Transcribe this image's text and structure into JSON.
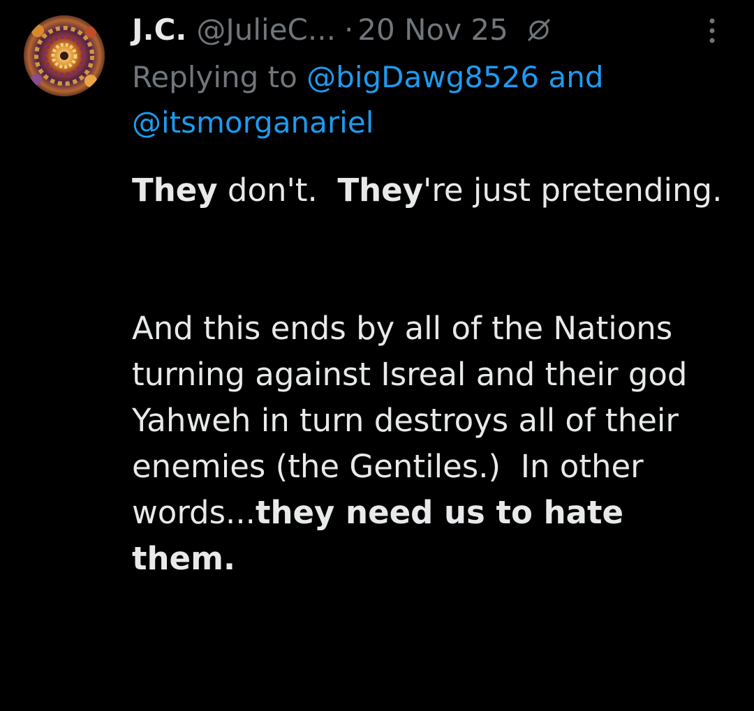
{
  "tweet": {
    "author_name": "J.C.",
    "author_handle": "@JulieC...",
    "separator": "·",
    "date": "20 Nov 25",
    "avatar_icon": "fractal-flower-avatar",
    "replying_prefix": "Replying to",
    "mention_1": "@bigDawg8526",
    "replying_and": "and",
    "mention_2": "@itsmorganariel",
    "paragraph_1": {
      "bold_1": "They",
      "text_1": " don't.  ",
      "bold_2": "They",
      "text_2": "'re just pretending."
    },
    "paragraph_2": {
      "text_1": "And this ends by all of the Nations turning against Isreal and their god Yahweh in turn destroys all of their enemies (the Gentiles.)  In other words...",
      "bold_1": "they need us to hate them."
    }
  },
  "colors": {
    "background": "#000000",
    "text_primary": "#e7e9ea",
    "text_secondary": "#71767b",
    "link": "#1d9bf0"
  }
}
